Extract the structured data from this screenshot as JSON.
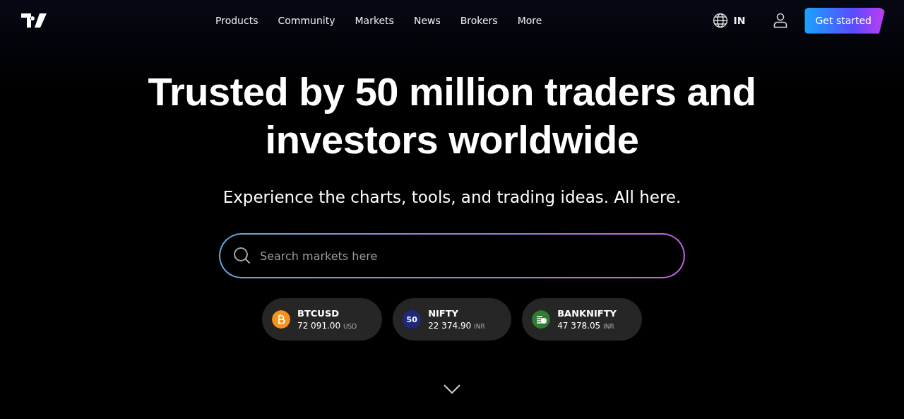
{
  "nav": {
    "links": [
      "Products",
      "Community",
      "Markets",
      "News",
      "Brokers",
      "More"
    ],
    "region": "IN",
    "cta": "Get started"
  },
  "hero": {
    "title": "Trusted by 50 million traders and investors worldwide",
    "subtitle": "Experience the charts, tools, and trading ideas. All here.",
    "search": {
      "placeholder": "Search markets here"
    },
    "tickers": [
      {
        "kind": "bitcoin",
        "symbol": "BTCUSD",
        "price": "72 091.00",
        "currency": "USD",
        "color": "#f7931a"
      },
      {
        "kind": "badge",
        "badge": "50",
        "symbol": "NIFTY",
        "price": "22 374.90",
        "currency": "INR",
        "color": "#1e2a78"
      },
      {
        "kind": "coins",
        "symbol": "BANKNIFTY",
        "price": "47 378.05",
        "currency": "INR",
        "color": "#2e7d32"
      }
    ]
  }
}
